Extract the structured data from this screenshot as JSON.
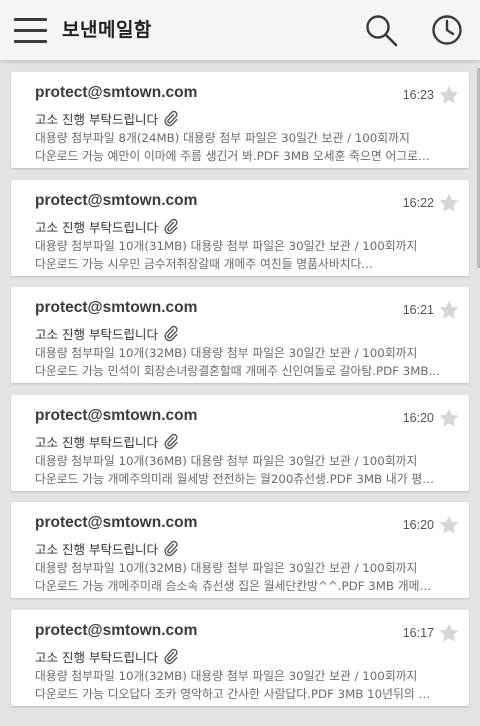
{
  "header": {
    "title": "보낸메일함",
    "menu_icon": "hamburger-menu-icon",
    "search_icon": "search-icon",
    "recent_icon": "clock-icon"
  },
  "colors": {
    "star": "#d6d6d6",
    "text_primary": "#3b3b3b",
    "text_secondary": "#6a6a6a"
  },
  "emails": [
    {
      "sender": "protect@smtown.com",
      "time": "16:23",
      "subject": "고소 진행 부탁드립니다",
      "preview_line1": "대용량 첨부파일 8개(24MB) 대용량 첨부 파일은 30일간 보관 / 100회까지",
      "preview_line2": "다운로드 가능 예만이 이마에 주름 생긴거 봐.PDF 3MB 오세훈 죽으면 어그로는..."
    },
    {
      "sender": "protect@smtown.com",
      "time": "16:22",
      "subject": "고소 진행 부탁드립니다",
      "preview_line1": "대용량 첨부파일 10개(31MB) 대용량 첨부 파일은 30일간 보관 / 100회까지",
      "preview_line2": "다운로드 가능 시우민 금수저취장갈때 개메주 여친들 명품사바치다..."
    },
    {
      "sender": "protect@smtown.com",
      "time": "16:21",
      "subject": "고소 진행 부탁드립니다",
      "preview_line1": "대용량 첨부파일 10개(32MB) 대용량 첨부 파일은 30일간 보관 / 100회까지",
      "preview_line2": "다운로드 가능 민석이 회장손녀랑결혼할때 개메주 신인여돌로 갈아탐.PDF 3MB..."
    },
    {
      "sender": "protect@smtown.com",
      "time": "16:20",
      "subject": "고소 진행 부탁드립니다",
      "preview_line1": "대용량 첨부파일 10개(36MB) 대용량 첨부 파일은 30일간 보관 / 100회까지",
      "preview_line2": "다운로드 가능 개메주의미래 월세방 전전하는 월200츄선생.PDF 3MB 내가 평생..."
    },
    {
      "sender": "protect@smtown.com",
      "time": "16:20",
      "subject": "고소 진행 부탁드립니다",
      "preview_line1": "대용량 첨부파일 10개(32MB) 대용량 첨부 파일은 30일간 보관 / 100회까지",
      "preview_line2": "다운로드 가능 개메주미래 슴소속 츄선생 집은 월세단칸방^^.PDF 3MB 개메주애..."
    },
    {
      "sender": "protect@smtown.com",
      "time": "16:17",
      "subject": "고소 진행 부탁드립니다",
      "preview_line1": "대용량 첨부파일 10개(32MB) 대용량 첨부 파일은 30일간 보관 / 100회까지",
      "preview_line2": "다운로드 가능 디오답다 조카 영악하고 간사한 사람답다.PDF 3MB 10년뒤의 엑..."
    }
  ]
}
